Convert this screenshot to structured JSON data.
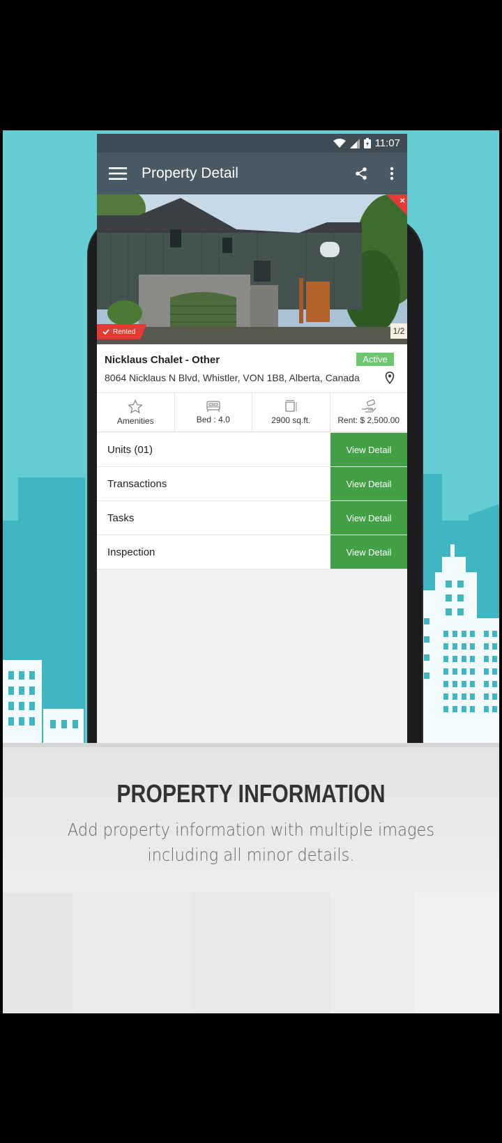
{
  "status_bar": {
    "time": "11:07"
  },
  "app_bar": {
    "title": "Property Detail"
  },
  "hero": {
    "status_label": "Rented",
    "image_counter": "1/2",
    "close_glyph": "×"
  },
  "property": {
    "name": "Nicklaus Chalet - Other",
    "status": "Active",
    "address": "8064 Nicklaus N Blvd, Whistler, VON 1B8, Alberta, Canada"
  },
  "stats": [
    {
      "icon": "star-icon",
      "label": "Amenities"
    },
    {
      "icon": "bed-icon",
      "label": "Bed : 4.0"
    },
    {
      "icon": "area-icon",
      "label": "2900 sq.ft."
    },
    {
      "icon": "money-hand-icon",
      "label": "Rent: $ 2,500.00"
    }
  ],
  "sections": [
    {
      "label": "Units (01)",
      "button": "View Detail"
    },
    {
      "label": "Transactions",
      "button": "View Detail"
    },
    {
      "label": "Tasks",
      "button": "View Detail"
    },
    {
      "label": "Inspection",
      "button": "View Detail"
    }
  ],
  "caption": {
    "heading": "PROPERTY INFORMATION",
    "line1": "Add property information with multiple images",
    "line2": "including all minor details."
  },
  "colors": {
    "background": "#64ccd3",
    "appbar": "#4a5a64",
    "button": "#43a047",
    "badge": "#6cc56f",
    "rented": "#e23a34"
  }
}
